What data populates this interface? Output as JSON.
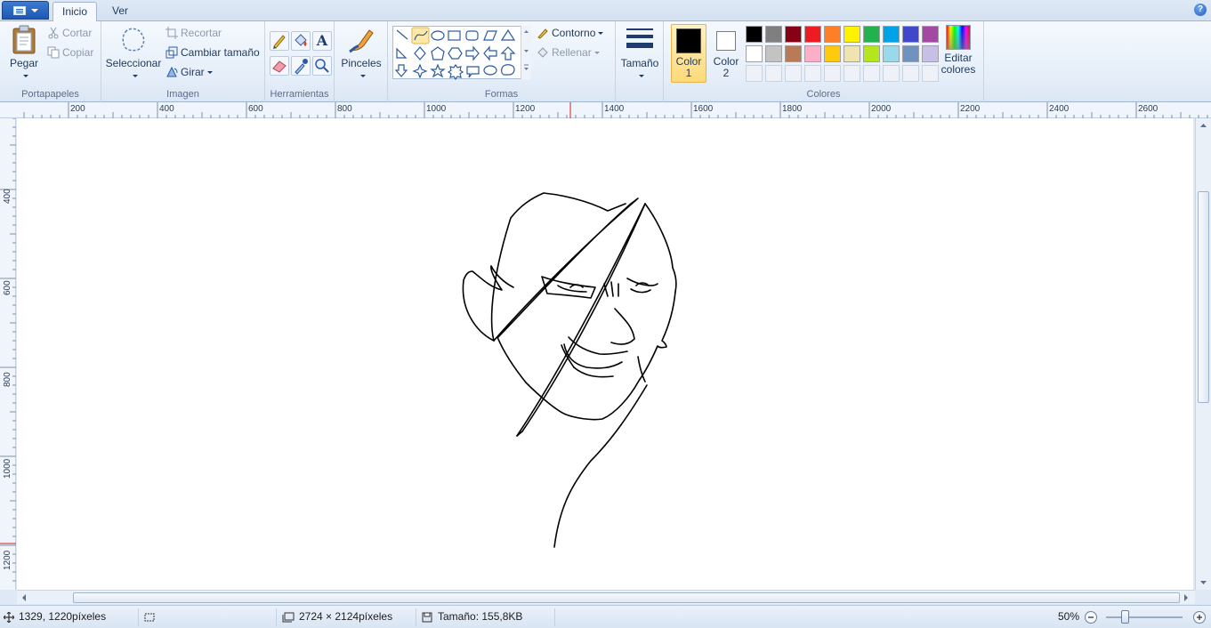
{
  "tabs": {
    "home": "Inicio",
    "view": "Ver"
  },
  "clipboard": {
    "paste": "Pegar",
    "cut": "Cortar",
    "copy": "Copiar",
    "group": "Portapapeles"
  },
  "image": {
    "select": "Seleccionar",
    "crop": "Recortar",
    "resize": "Cambiar tamaño",
    "rotate": "Girar",
    "group": "Imagen"
  },
  "tools": {
    "group": "Herramientas",
    "text_glyph": "A"
  },
  "brushes": {
    "label": "Pinceles"
  },
  "shapes": {
    "outline": "Contorno",
    "fill": "Rellenar",
    "group": "Formas"
  },
  "size": {
    "label": "Tamaño"
  },
  "colors": {
    "color1_line1": "Color",
    "color1_line2": "1",
    "color2_line1": "Color",
    "color2_line2": "2",
    "color1_value": "#000000",
    "color2_value": "#ffffff",
    "edit_line1": "Editar",
    "edit_line2": "colores",
    "group": "Colores",
    "palette_row1": [
      "#000000",
      "#7f7f7f",
      "#880015",
      "#ed1c24",
      "#ff7f27",
      "#fff200",
      "#22b14c",
      "#00a2e8",
      "#3f48cc",
      "#a349a4"
    ],
    "palette_row2": [
      "#ffffff",
      "#c3c3c3",
      "#b97a57",
      "#ffaec9",
      "#ffc90e",
      "#efe4b0",
      "#b5e61d",
      "#99d9ea",
      "#7092be",
      "#c8bfe7"
    ]
  },
  "ruler": {
    "h_labels": [
      "200",
      "400",
      "600",
      "800",
      "1000",
      "1200",
      "1400",
      "1600",
      "1800",
      "2000",
      "2200",
      "2400",
      "2600"
    ],
    "v_labels": [
      "400",
      "600",
      "800",
      "1000",
      "1200"
    ]
  },
  "status": {
    "cursor_pos": "1329, 1220píxeles",
    "dimensions": "2724 × 2124píxeles",
    "file_size": "Tamaño: 155,8KB",
    "zoom": "50%"
  }
}
